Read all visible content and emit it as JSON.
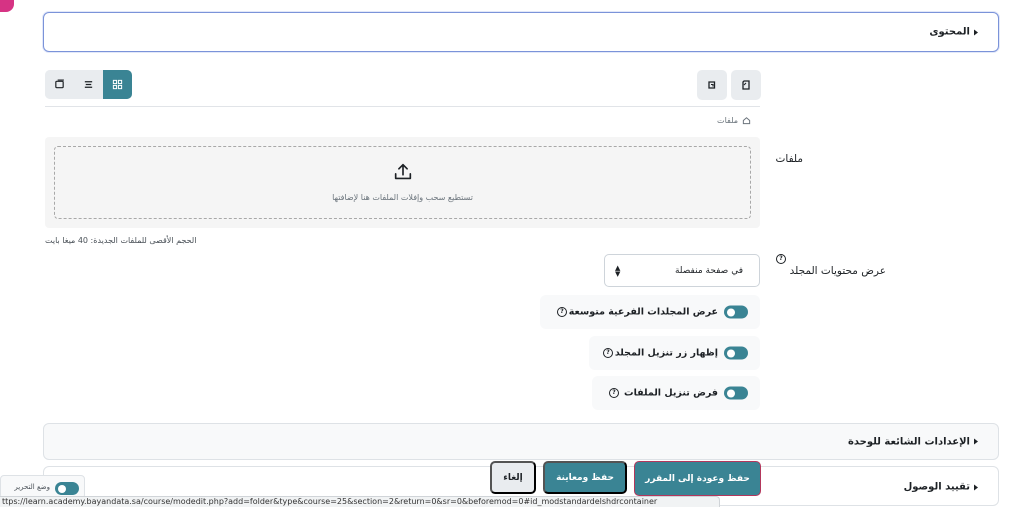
{
  "sections": {
    "content": "المحتوى",
    "common_settings": "الإعدادات الشائعة للوحدة",
    "restrict_access": "تقييد الوصول"
  },
  "files": {
    "label": "ملفات",
    "path_label": "ملفات",
    "drop_hint": "تستطيع سحب وإفلات الملفات هنا لإضافتها",
    "max_size": "الحجم الأقصى للملفات الجديدة: 40 ميغا بايت"
  },
  "display": {
    "label": "عرض محتويات المجلد",
    "selected": "في صفحة منفصلة"
  },
  "toggles": [
    {
      "label": "عرض المجلدات الفرعية متوسعة"
    },
    {
      "label": "إظهار زر تنزيل المجلد"
    },
    {
      "label": "فرض تنزيل الملفات"
    }
  ],
  "buttons": {
    "save_return": "حفظ وعودة إلى المقرر",
    "save_display": "حفظ ومعاينة",
    "cancel": "إلغاء"
  },
  "edit_mode": {
    "label": "وضع التحرير"
  },
  "status_url": "ttps://learn.academy.bayandata.sa/course/modedit.php?add=folder&type&course=25&section=2&return=0&sr=0&beforemod=0#id_modstandardelshdrcontainer",
  "colors": {
    "accent": "#3a8494",
    "focus_border": "#7b93d9",
    "primary_outline": "#b3375c"
  },
  "icons": {
    "help": "?"
  }
}
